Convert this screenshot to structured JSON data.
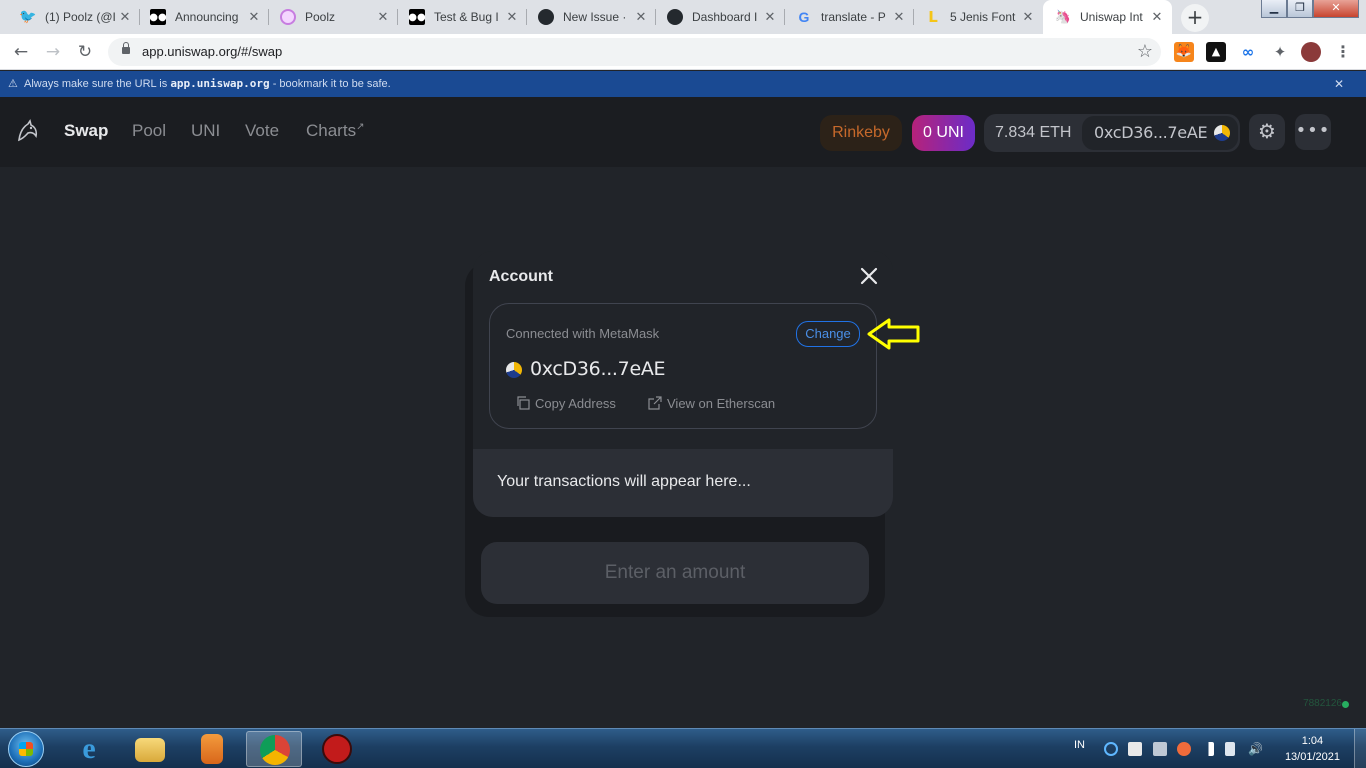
{
  "browser": {
    "tabs": [
      {
        "title": "(1) Poolz (@I",
        "icon": "twitter-icon",
        "color": "#1da1f2"
      },
      {
        "title": "Announcing",
        "icon": "medium-icon",
        "color": "#000000"
      },
      {
        "title": "Poolz",
        "icon": "poolz-icon",
        "color": "#c77de0"
      },
      {
        "title": "Test & Bug I",
        "icon": "medium-icon",
        "color": "#000000"
      },
      {
        "title": "New Issue · ",
        "icon": "github-icon",
        "color": "#24292e"
      },
      {
        "title": "Dashboard I",
        "icon": "github-icon",
        "color": "#24292e"
      },
      {
        "title": "translate - P",
        "icon": "google-icon",
        "color": "#4285f4"
      },
      {
        "title": "5 Jenis Font",
        "icon": "bookmark-l-icon",
        "color": "#f5c518"
      },
      {
        "title": "Uniswap Int",
        "icon": "uniswap-icon",
        "color": "#555555"
      }
    ],
    "url": "app.uniswap.org/#/swap"
  },
  "banner": {
    "prefix": "Always make sure the URL is ",
    "domain": "app.uniswap.org",
    "suffix": " - bookmark it to be safe."
  },
  "header": {
    "nav": [
      "Swap",
      "Pool",
      "UNI",
      "Vote",
      "Charts"
    ],
    "charts_arrow": "↗",
    "network": "Rinkeby",
    "uni_balance": "0 UNI",
    "eth_balance": "7.834 ETH",
    "address": "0xcD36...7eAE"
  },
  "modal": {
    "title": "Account",
    "connected_with": "Connected with MetaMask",
    "change_label": "Change",
    "address": "0xcD36...7eAE",
    "copy_label": "Copy Address",
    "etherscan_label": "View on Etherscan",
    "transactions_text": "Your transactions will appear here..."
  },
  "swap": {
    "button_label": "Enter an amount"
  },
  "status": {
    "block_number": "7882126"
  },
  "taskbar": {
    "language": "IN",
    "time": "1:04",
    "date": "13/01/2021"
  },
  "colors": {
    "accent_blue": "#2172e5",
    "network_orange": "#c6692b",
    "annotation_yellow": "#ffff00"
  }
}
